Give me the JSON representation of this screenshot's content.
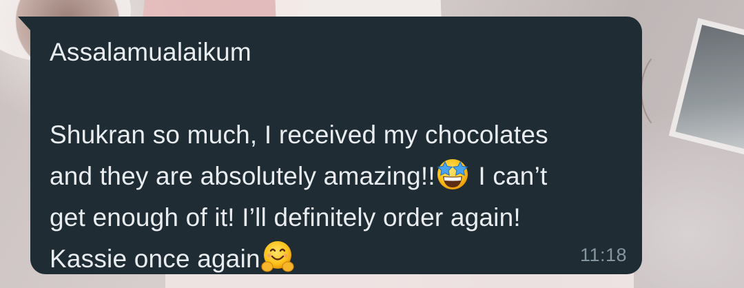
{
  "message": {
    "greeting": "Assalamualaikum",
    "line1": "Shukran so much, I received my chocolates",
    "line2_before_emoji": "and they are absolutely amazing!!",
    "line2_after_emoji": " I can’t",
    "line3": "get enough of it! I’ll definitely order again!",
    "line4": "Kassie once again",
    "emoji_1": "star-struck-emoji",
    "emoji_2": "hugging-face-emoji",
    "timestamp": "11:18"
  },
  "colors": {
    "bubble_background": "#1f2c34",
    "message_text": "#e9edef",
    "timestamp_text": "#8696a0"
  }
}
